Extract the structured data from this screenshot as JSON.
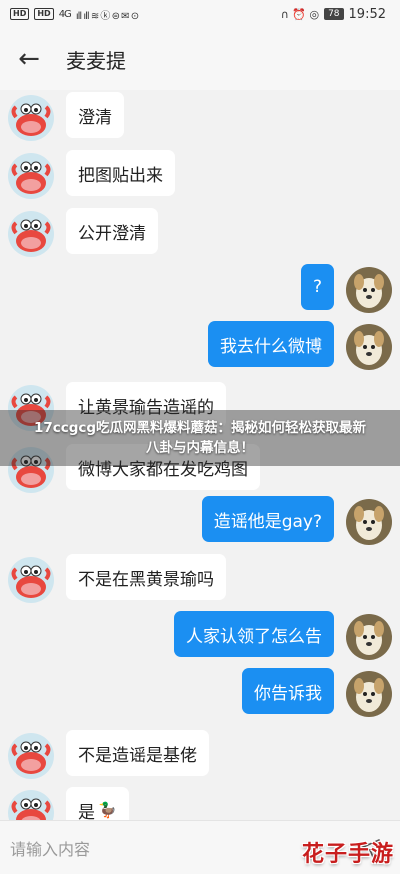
{
  "status_bar": {
    "left_chips": [
      "HD",
      "HD"
    ],
    "left_signal": "4G",
    "left_icons": "ıll ıll ≋ ⓚ ⊜ ✉ ⊙",
    "right_icons": "∩ ⏰ ◎",
    "battery": "78",
    "time": "19:52"
  },
  "header": {
    "back_glyph": "←",
    "title": "麦麦提"
  },
  "messages": [
    {
      "side": "left",
      "text": "澄清"
    },
    {
      "side": "left",
      "text": "把图贴出来"
    },
    {
      "side": "left",
      "text": "公开澄清"
    },
    {
      "side": "right",
      "text": "?"
    },
    {
      "side": "right",
      "text": "我去什么微博"
    },
    {
      "side": "left",
      "text": "让黄景瑜告造谣的"
    },
    {
      "side": "left",
      "text": "微博大家都在发吃鸡图"
    },
    {
      "side": "right",
      "text": "造谣他是gay?"
    },
    {
      "side": "left",
      "text": "不是在黑黄景瑜吗"
    },
    {
      "side": "right",
      "text": "人家认领了怎么告"
    },
    {
      "side": "right",
      "text": "你告诉我"
    },
    {
      "side": "left",
      "text": "不是造谣是基佬"
    },
    {
      "side": "left",
      "text": "是",
      "emoji": "🦆"
    }
  ],
  "overlay": {
    "line1": "17ccgcg吃瓜网黑料爆料蘑菇：揭秘如何轻松获取最新",
    "line2": "八卦与内幕信息！"
  },
  "input": {
    "placeholder": "请输入内容"
  },
  "watermark": "花子手游",
  "colors": {
    "bubble_sent": "#1b8ff2",
    "bubble_received": "#ffffff",
    "chat_background": "#f2f2f2"
  },
  "icons": {
    "left_avatar": "crab-cartoon-avatar",
    "right_avatar": "dog-photo-avatar",
    "back": "back-arrow-icon",
    "send": "send-icon"
  }
}
